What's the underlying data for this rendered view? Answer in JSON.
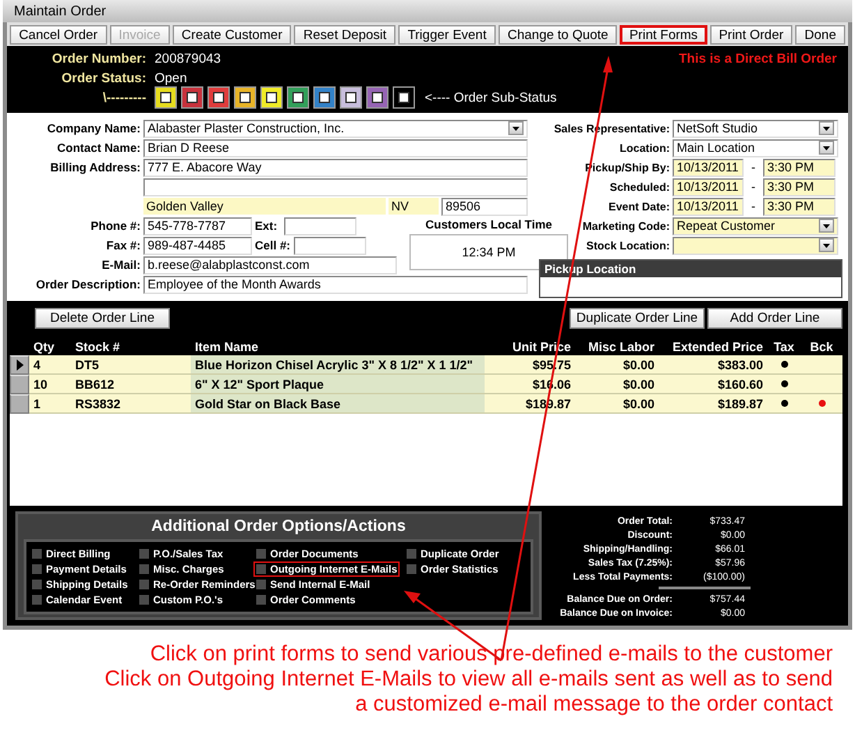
{
  "window": {
    "title": "Maintain Order"
  },
  "toolbar": {
    "buttons": [
      {
        "label": "Cancel Order",
        "disabled": false,
        "highlighted": false
      },
      {
        "label": "Invoice",
        "disabled": true,
        "highlighted": false
      },
      {
        "label": "Create Customer",
        "disabled": false,
        "highlighted": false
      },
      {
        "label": "Reset Deposit",
        "disabled": false,
        "highlighted": false
      },
      {
        "label": "Trigger Event",
        "disabled": false,
        "highlighted": false
      },
      {
        "label": "Change to Quote",
        "disabled": false,
        "highlighted": false
      },
      {
        "label": "Print Forms",
        "disabled": false,
        "highlighted": true
      },
      {
        "label": "Print Order",
        "disabled": false,
        "highlighted": false
      },
      {
        "label": "Done",
        "disabled": false,
        "highlighted": false
      }
    ]
  },
  "header": {
    "order_number_label": "Order Number:",
    "order_number": "200879043",
    "order_status_label": "Order Status:",
    "order_status": "Open",
    "sub_status_prefix": "\\---------",
    "sub_status_swatches": [
      {
        "color": "#e6dc1e"
      },
      {
        "color": "#c8323c"
      },
      {
        "color": "#e03c3c"
      },
      {
        "color": "#e8b428"
      },
      {
        "color": "#f0eb28"
      },
      {
        "color": "#32a05a"
      },
      {
        "color": "#3282c8"
      },
      {
        "color": "#c8bedc"
      },
      {
        "color": "#9664b4"
      },
      {
        "color": "#000000"
      }
    ],
    "sub_status_label": "<---- Order Sub-Status",
    "notice": "This is a Direct Bill Order"
  },
  "customer": {
    "company_name": {
      "label": "Company Name:",
      "value": "Alabaster Plaster Construction, Inc."
    },
    "contact_name": {
      "label": "Contact Name:",
      "value": "Brian D Reese"
    },
    "billing_address": {
      "label": "Billing Address:",
      "value": "777 E. Abacore Way"
    },
    "city": "Golden Valley",
    "state": "NV",
    "zip": "89506",
    "phone": {
      "label": "Phone #:",
      "value": "545-778-7787"
    },
    "ext": {
      "label": "Ext:"
    },
    "fax": {
      "label": "Fax #:",
      "value": "989-487-4485"
    },
    "cell": {
      "label": "Cell #:"
    },
    "email": {
      "label": "E-Mail:",
      "value": "b.reese@alabplastconst.com"
    },
    "local_time": {
      "label": "Customers Local Time",
      "value": "12:34 PM"
    },
    "order_description": {
      "label": "Order Description:",
      "value": "Employee of the Month Awards"
    }
  },
  "order": {
    "sales_rep": {
      "label": "Sales Representative:",
      "value": "NetSoft Studio"
    },
    "location": {
      "label": "Location:",
      "value": "Main Location"
    },
    "dates": [
      {
        "label": "Pickup/Ship By:",
        "date": "10/13/2011",
        "separator": "-",
        "time": "3:30 PM"
      },
      {
        "label": "Scheduled:",
        "date": "10/13/2011",
        "separator": "-",
        "time": "3:30 PM"
      },
      {
        "label": "Event Date:",
        "date": "10/13/2011",
        "separator": "-",
        "time": "3:30 PM"
      }
    ],
    "marketing_code": {
      "label": "Marketing Code:",
      "value": "Repeat Customer"
    },
    "stock_location": {
      "label": "Stock Location:"
    },
    "pickup_location": {
      "title": "Pickup Location"
    }
  },
  "line_items": {
    "buttons": [
      "Delete Order Line",
      "Duplicate Order Line",
      "Add Order Line"
    ],
    "columns": [
      "Qty",
      "Stock #",
      "Item Name",
      "Unit Price",
      "Misc Labor",
      "Extended Price",
      "Tax",
      "Bck"
    ],
    "rows": [
      {
        "selected": true,
        "qty": "4",
        "stock": "DT5",
        "item": "Blue Horizon Chisel Acrylic 3\" X 8 1/2\" X 1 1/2\"",
        "unit_price": "$95.75",
        "misc_labor": "$0.00",
        "extended_price": "$383.00",
        "tax": true,
        "backorder": false
      },
      {
        "selected": false,
        "qty": "10",
        "stock": "BB612",
        "item": "6\" X 12\" Sport Plaque",
        "unit_price": "$16.06",
        "misc_labor": "$0.00",
        "extended_price": "$160.60",
        "tax": true,
        "backorder": false
      },
      {
        "selected": false,
        "qty": "1",
        "stock": "RS3832",
        "item": "Gold Star on Black Base",
        "unit_price": "$189.87",
        "misc_labor": "$0.00",
        "extended_price": "$189.87",
        "tax": true,
        "backorder": true
      }
    ]
  },
  "options": {
    "title": "Additional Order Options/Actions",
    "columns": [
      {
        "items": [
          {
            "label": "Direct Billing",
            "checked": false,
            "highlighted": false
          },
          {
            "label": "Payment Details",
            "checked": false,
            "highlighted": false
          },
          {
            "label": "Shipping Details",
            "checked": false,
            "highlighted": false
          },
          {
            "label": "Calendar Event",
            "checked": false,
            "highlighted": false
          }
        ]
      },
      {
        "items": [
          {
            "label": "P.O./Sales Tax",
            "checked": false,
            "highlighted": false
          },
          {
            "label": "Misc. Charges",
            "checked": false,
            "highlighted": false
          },
          {
            "label": "Re-Order Reminders",
            "checked": false,
            "highlighted": false
          },
          {
            "label": "Custom P.O.'s",
            "checked": false,
            "highlighted": false
          }
        ]
      },
      {
        "items": [
          {
            "label": "Order Documents",
            "checked": false,
            "highlighted": false
          },
          {
            "label": "Outgoing Internet E-Mails",
            "checked": false,
            "highlighted": true
          },
          {
            "label": "Send Internal E-Mail",
            "checked": false,
            "highlighted": false
          },
          {
            "label": "Order Comments",
            "checked": false,
            "highlighted": false
          }
        ]
      },
      {
        "items": [
          {
            "label": "Duplicate Order",
            "checked": false,
            "highlighted": false
          },
          {
            "label": "Order Statistics",
            "checked": false,
            "highlighted": false
          }
        ]
      }
    ]
  },
  "totals": {
    "rows": [
      {
        "label": "Order Total:",
        "value": "$733.47"
      },
      {
        "label": "Discount:",
        "value": "$0.00"
      },
      {
        "label": "Shipping/Handling:",
        "value": "$66.01"
      },
      {
        "label": "Sales Tax (7.25%):",
        "value": "$57.96"
      },
      {
        "label": "Less Total Payments:",
        "value": "($100.00)"
      }
    ],
    "balances": [
      {
        "label": "Balance Due on Order:",
        "value": "$757.44"
      },
      {
        "label": "Balance Due on Invoice:",
        "value": "$0.00"
      }
    ]
  },
  "annotation": {
    "lines": [
      "Click on print forms to send various pre-defined e-mails to the customer",
      "Click on Outgoing Internet E-Mails to view all e-mails sent as well as to send",
      "a customized e-mail message to the order contact"
    ]
  }
}
